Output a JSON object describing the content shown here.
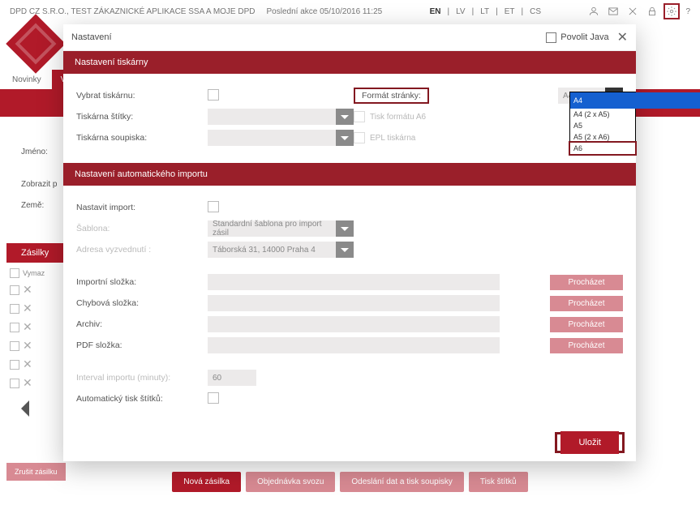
{
  "top": {
    "company_text": "DPD CZ S.R.O., TEST ZÁKAZNICKÉ APLIKACE SSA A MOJE DPD",
    "last_action": "Poslední akce 05/10/2016 11:25",
    "langs": [
      "EN",
      "LV",
      "LT",
      "ET",
      "CS"
    ],
    "active_lang": "EN",
    "help": "?"
  },
  "tabs": {
    "items": [
      "Novinky",
      "Vytvoř"
    ],
    "active": 1
  },
  "bg": {
    "label_jmeno": "Jméno:",
    "label_zobrazit": "Zobrazit p",
    "label_zeme": "Země:",
    "subtab": "Zásilky",
    "row_label": "Vymaz",
    "cancel_shipment": "Zrušit zásilku"
  },
  "footer": {
    "new": "Nová zásilka",
    "order": "Objednávka svozu",
    "send": "Odeslání dat a tisk soupisky",
    "labels": "Tisk štítků"
  },
  "modal": {
    "title": "Nastavení",
    "allow_java": "Povolit Java",
    "section_printer": "Nastavení tiskárny",
    "select_printer": "Vybrat tiskárnu:",
    "printer_labels": "Tiskárna štítky:",
    "printer_list": "Tiskárna soupiska:",
    "page_format": "Formát stránky:",
    "a6_print": "Tisk formátu A6",
    "epl_printer": "EPL tiskárna",
    "format_selected": "A4",
    "format_options": [
      "A4",
      "A4 (2 x A5)",
      "A5",
      "A5 (2 x A6)",
      "A6"
    ],
    "section_import": "Nastavení automatického importu",
    "set_import": "Nastavit import:",
    "template": "Šablona:",
    "template_value": "Standardní šablona pro import zásil",
    "pickup_addr": "Adresa vyzvednutí :",
    "pickup_value": "Táborská 31, 14000 Praha 4",
    "import_folder": "Importní složka:",
    "error_folder": "Chybová složka:",
    "archive": "Archiv:",
    "pdf_folder": "PDF složka:",
    "browse": "Procházet",
    "interval": "Interval importu (minuty):",
    "interval_value": "60",
    "auto_print": "Automatický tisk štítků:",
    "save": "Uložit"
  }
}
